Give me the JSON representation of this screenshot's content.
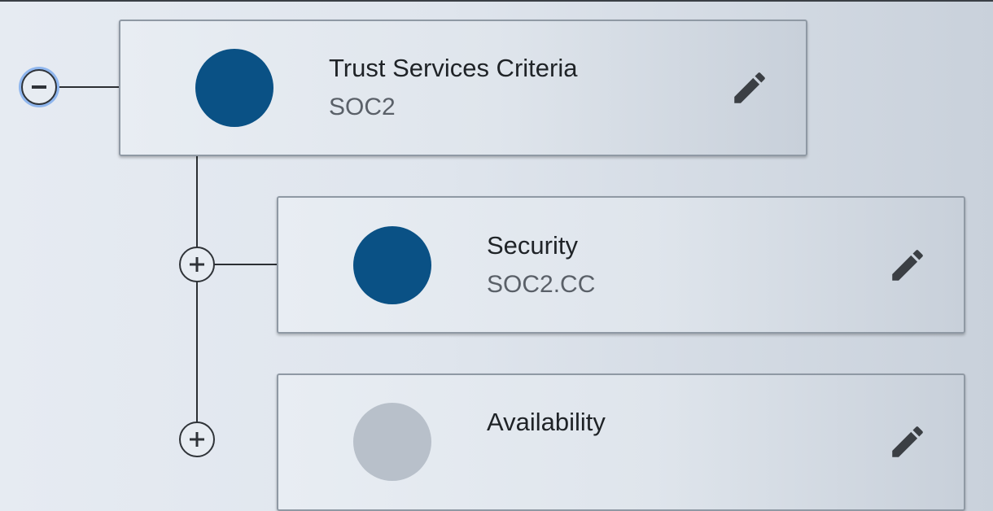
{
  "colors": {
    "dot_active": "#0a5185",
    "dot_inactive": "#b8c0ca",
    "icon": "#3b3f44",
    "line": "#2b2f33",
    "focus_ring": "#8fb6ee"
  },
  "tree": {
    "root": {
      "toggle_icon": "minus-circle-icon",
      "title": "Trust Services Criteria",
      "code": "SOC2",
      "edit_icon": "pencil-icon"
    },
    "children": [
      {
        "toggle_icon": "plus-circle-icon",
        "title": "Security",
        "code": "SOC2.CC",
        "edit_icon": "pencil-icon"
      },
      {
        "toggle_icon": "plus-circle-icon",
        "title": "Availability",
        "code": "",
        "edit_icon": "pencil-icon"
      }
    ]
  }
}
